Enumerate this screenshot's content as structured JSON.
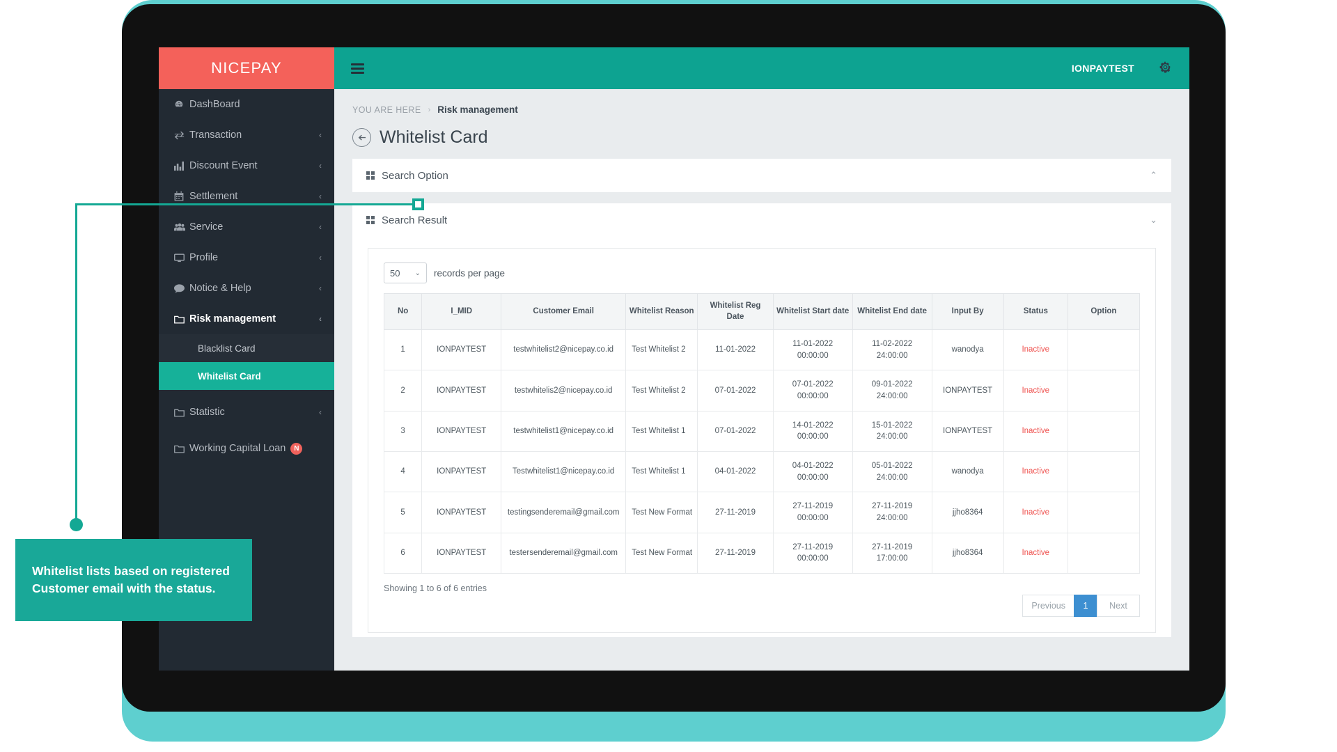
{
  "brand": {
    "name": "NICEPAY"
  },
  "topbar": {
    "menu_icon": "hamburger-icon",
    "user": "IONPAYTEST",
    "settings_icon": "gear-icon"
  },
  "sidebar": {
    "items": [
      {
        "label": "DashBoard",
        "icon": "dashboard-icon",
        "glyph": "◔",
        "caret": ""
      },
      {
        "label": "Transaction",
        "icon": "transaction-icon",
        "glyph": "⇄",
        "caret": "‹"
      },
      {
        "label": "Discount Event",
        "icon": "chart-bar-icon",
        "glyph": "█",
        "caret": "‹"
      },
      {
        "label": "Settlement",
        "icon": "calendar-icon",
        "glyph": "☷",
        "caret": "‹"
      },
      {
        "label": "Service",
        "icon": "users-icon",
        "glyph": "⛟",
        "caret": "‹"
      },
      {
        "label": "Profile",
        "icon": "monitor-icon",
        "glyph": "▭",
        "caret": "‹"
      },
      {
        "label": "Notice & Help",
        "icon": "chat-bubble-icon",
        "glyph": "●",
        "caret": "‹"
      },
      {
        "label": "Risk management",
        "icon": "folder-icon",
        "glyph": "▱",
        "caret": "‹",
        "active": true
      }
    ],
    "sub_items": [
      {
        "label": "Blacklist Card",
        "selected": false
      },
      {
        "label": "Whitelist Card",
        "selected": true
      }
    ],
    "bottom_items": [
      {
        "label": "Statistic",
        "icon": "folder-icon",
        "glyph": "▱",
        "caret": "‹",
        "badge": ""
      },
      {
        "label": "Working Capital Loan",
        "icon": "folder-icon",
        "glyph": "▱",
        "caret": "",
        "badge": "N"
      }
    ]
  },
  "breadcrumb": {
    "prefix": "YOU ARE HERE",
    "separator": "›",
    "current": "Risk management"
  },
  "page": {
    "title": "Whitelist Card",
    "back_icon": "back-arrow-icon"
  },
  "panels": {
    "search_option": {
      "title": "Search Option",
      "chevron": "⌃"
    },
    "search_result": {
      "title": "Search Result",
      "chevron": "⌄"
    }
  },
  "table_controls": {
    "records_per_page_value": "50",
    "records_per_page_label": "records per page",
    "caret": "⌄"
  },
  "table": {
    "columns": [
      "No",
      "I_MID",
      "Customer Email",
      "Whitelist Reason",
      "Whitelist Reg Date",
      "Whitelist Start date",
      "Whitelist End date",
      "Input By",
      "Status",
      "Option"
    ],
    "rows": [
      {
        "no": "1",
        "mid": "IONPAYTEST",
        "email": "testwhitelist2@nicepay.co.id",
        "reason": "Test Whitelist 2",
        "reg_date": "11-01-2022",
        "start_date": "11-01-2022 00:00:00",
        "end_date": "11-02-2022 24:00:00",
        "input_by": "wanodya",
        "status": "Inactive",
        "option": ""
      },
      {
        "no": "2",
        "mid": "IONPAYTEST",
        "email": "testwhitelis2@nicepay.co.id",
        "reason": "Test Whitelist 2",
        "reg_date": "07-01-2022",
        "start_date": "07-01-2022 00:00:00",
        "end_date": "09-01-2022 24:00:00",
        "input_by": "IONPAYTEST",
        "status": "Inactive",
        "option": ""
      },
      {
        "no": "3",
        "mid": "IONPAYTEST",
        "email": "testwhitelist1@nicepay.co.id",
        "reason": "Test Whitelist 1",
        "reg_date": "07-01-2022",
        "start_date": "14-01-2022 00:00:00",
        "end_date": "15-01-2022 24:00:00",
        "input_by": "IONPAYTEST",
        "status": "Inactive",
        "option": ""
      },
      {
        "no": "4",
        "mid": "IONPAYTEST",
        "email": "Testwhitelist1@nicepay.co.id",
        "reason": "Test Whitelist 1",
        "reg_date": "04-01-2022",
        "start_date": "04-01-2022 00:00:00",
        "end_date": "05-01-2022 24:00:00",
        "input_by": "wanodya",
        "status": "Inactive",
        "option": ""
      },
      {
        "no": "5",
        "mid": "IONPAYTEST",
        "email": "testingsenderemail@gmail.com",
        "reason": "Test New Format",
        "reg_date": "27-11-2019",
        "start_date": "27-11-2019 00:00:00",
        "end_date": "27-11-2019 24:00:00",
        "input_by": "jjho8364",
        "status": "Inactive",
        "option": ""
      },
      {
        "no": "6",
        "mid": "IONPAYTEST",
        "email": "testersenderemail@gmail.com",
        "reason": "Test New Format",
        "reg_date": "27-11-2019",
        "start_date": "27-11-2019 00:00:00",
        "end_date": "27-11-2019 17:00:00",
        "input_by": "jjho8364",
        "status": "Inactive",
        "option": ""
      }
    ]
  },
  "footer": {
    "showing": "Showing 1 to 6 of 6 entries",
    "pagination": {
      "previous": "Previous",
      "current_page": "1",
      "next": "Next"
    }
  },
  "callout": {
    "text": "Whitelist lists based on registered Customer email with the status."
  },
  "colors": {
    "brand_red": "#f4615a",
    "topbar_teal": "#0da391",
    "sidebar_dark": "#222a33",
    "accent_teal": "#16b199",
    "callout_teal": "#19a898",
    "status_red": "#ef5350",
    "pager_blue": "#3d8fd1",
    "frame_teal": "#5ecfcf"
  }
}
